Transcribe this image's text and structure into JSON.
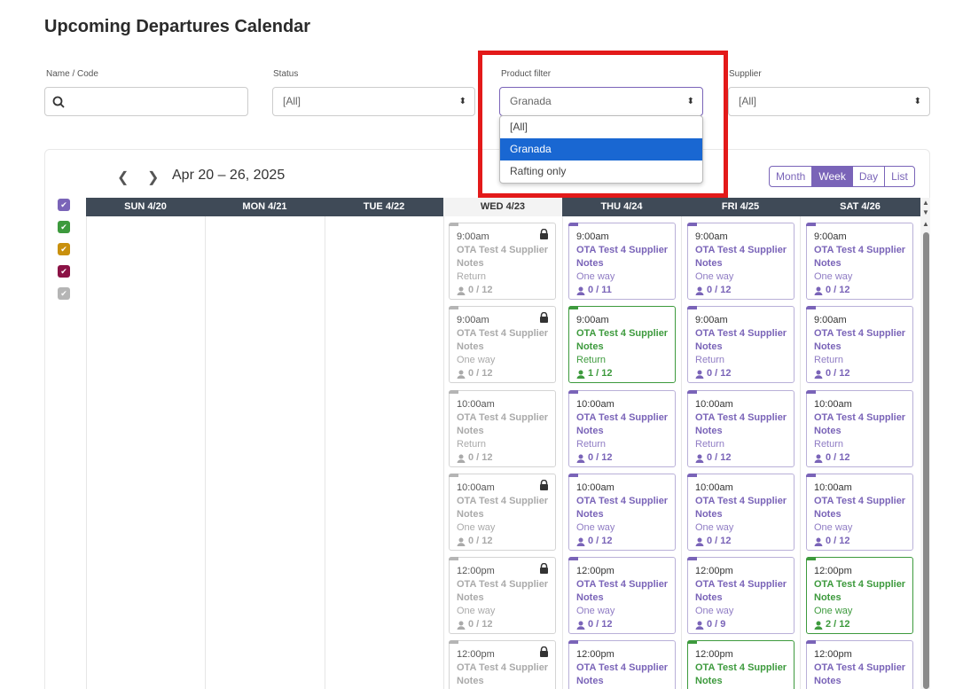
{
  "page": {
    "title": "Upcoming Departures Calendar"
  },
  "filters": {
    "name_label": "Name / Code",
    "name_placeholder": "",
    "status_label": "Status",
    "status_value": "[All]",
    "product_label": "Product filter",
    "product_value": "Granada",
    "product_options": [
      "[All]",
      "Granada",
      "Rafting only"
    ],
    "supplier_label": "Supplier",
    "supplier_value": "[All]"
  },
  "calendar": {
    "range": "Apr 20 – 26, 2025",
    "views": [
      "Month",
      "Week",
      "Day",
      "List"
    ],
    "active_view": "Week",
    "legend_colors": [
      "#7a64b8",
      "#3d9a3d",
      "#c9900d",
      "#8b1245",
      "#b5b5b5"
    ],
    "days": [
      "SUN 4/20",
      "MON 4/21",
      "TUE 4/22",
      "WED 4/23",
      "THU 4/24",
      "FRI 4/25",
      "SAT 4/26"
    ],
    "events": {
      "wed": [
        {
          "time": "9:00am",
          "name": "OTA Test 4 Supplier",
          "notes": "Notes",
          "type": "Return",
          "count": "0 / 12",
          "style": "gray",
          "locked": true
        },
        {
          "time": "9:00am",
          "name": "OTA Test 4 Supplier",
          "notes": "Notes",
          "type": "One way",
          "count": "0 / 12",
          "style": "gray",
          "locked": true
        },
        {
          "time": "10:00am",
          "name": "OTA Test 4 Supplier",
          "notes": "Notes",
          "type": "Return",
          "count": "0 / 12",
          "style": "gray",
          "locked": false
        },
        {
          "time": "10:00am",
          "name": "OTA Test 4 Supplier",
          "notes": "Notes",
          "type": "One way",
          "count": "0 / 12",
          "style": "gray",
          "locked": true
        },
        {
          "time": "12:00pm",
          "name": "OTA Test 4 Supplier",
          "notes": "Notes",
          "type": "One way",
          "count": "0 / 12",
          "style": "gray",
          "locked": true
        },
        {
          "time": "12:00pm",
          "name": "OTA Test 4 Supplier",
          "notes": "Notes",
          "type": "",
          "count": "",
          "style": "gray",
          "locked": true
        }
      ],
      "thu": [
        {
          "time": "9:00am",
          "name": "OTA Test 4 Supplier",
          "notes": "Notes",
          "type": "One way",
          "count": "0 / 11",
          "style": "purple"
        },
        {
          "time": "9:00am",
          "name": "OTA Test 4 Supplier",
          "notes": "Notes",
          "type": "Return",
          "count": "1 / 12",
          "style": "green"
        },
        {
          "time": "10:00am",
          "name": "OTA Test 4 Supplier",
          "notes": "Notes",
          "type": "Return",
          "count": "0 / 12",
          "style": "purple"
        },
        {
          "time": "10:00am",
          "name": "OTA Test 4 Supplier",
          "notes": "Notes",
          "type": "One way",
          "count": "0 / 12",
          "style": "purple"
        },
        {
          "time": "12:00pm",
          "name": "OTA Test 4 Supplier",
          "notes": "Notes",
          "type": "One way",
          "count": "0 / 12",
          "style": "purple"
        },
        {
          "time": "12:00pm",
          "name": "OTA Test 4 Supplier",
          "notes": "Notes",
          "type": "",
          "count": "",
          "style": "purple"
        }
      ],
      "fri": [
        {
          "time": "9:00am",
          "name": "OTA Test 4 Supplier",
          "notes": "Notes",
          "type": "One way",
          "count": "0 / 12",
          "style": "purple"
        },
        {
          "time": "9:00am",
          "name": "OTA Test 4 Supplier",
          "notes": "Notes",
          "type": "Return",
          "count": "0 / 12",
          "style": "purple"
        },
        {
          "time": "10:00am",
          "name": "OTA Test 4 Supplier",
          "notes": "Notes",
          "type": "Return",
          "count": "0 / 12",
          "style": "purple"
        },
        {
          "time": "10:00am",
          "name": "OTA Test 4 Supplier",
          "notes": "Notes",
          "type": "One way",
          "count": "0 / 12",
          "style": "purple"
        },
        {
          "time": "12:00pm",
          "name": "OTA Test 4 Supplier",
          "notes": "Notes",
          "type": "One way",
          "count": "0 / 9",
          "style": "purple"
        },
        {
          "time": "12:00pm",
          "name": "OTA Test 4 Supplier",
          "notes": "Notes",
          "type": "",
          "count": "",
          "style": "green"
        }
      ],
      "sat": [
        {
          "time": "9:00am",
          "name": "OTA Test 4 Supplier",
          "notes": "Notes",
          "type": "One way",
          "count": "0 / 12",
          "style": "purple"
        },
        {
          "time": "9:00am",
          "name": "OTA Test 4 Supplier",
          "notes": "Notes",
          "type": "Return",
          "count": "0 / 12",
          "style": "purple"
        },
        {
          "time": "10:00am",
          "name": "OTA Test 4 Supplier",
          "notes": "Notes",
          "type": "Return",
          "count": "0 / 12",
          "style": "purple"
        },
        {
          "time": "10:00am",
          "name": "OTA Test 4 Supplier",
          "notes": "Notes",
          "type": "One way",
          "count": "0 / 12",
          "style": "purple"
        },
        {
          "time": "12:00pm",
          "name": "OTA Test 4 Supplier",
          "notes": "Notes",
          "type": "One way",
          "count": "2 / 12",
          "style": "green"
        },
        {
          "time": "12:00pm",
          "name": "OTA Test 4 Supplier",
          "notes": "Notes",
          "type": "",
          "count": "",
          "style": "purple"
        }
      ]
    }
  }
}
